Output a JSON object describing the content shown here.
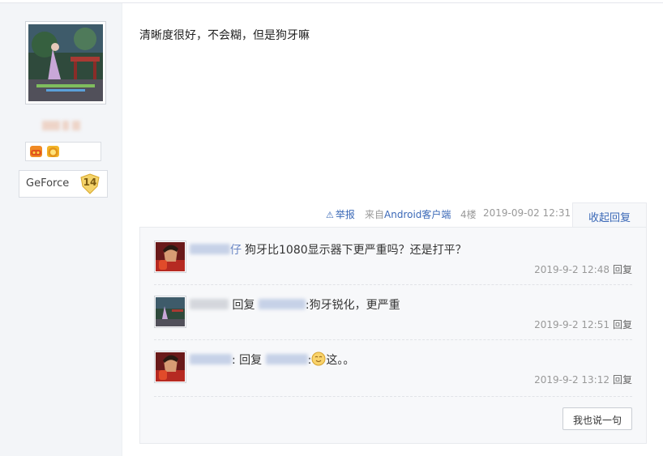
{
  "post": {
    "content": "清晰度很好，不会糊，但是狗牙嘛"
  },
  "author": {
    "level_name": "GeForce",
    "level_number": "14"
  },
  "meta": {
    "report_label": "举报",
    "from_prefix": "来自",
    "from_client": "Android客户端",
    "floor": "4楼",
    "time": "2019-09-02 12:31",
    "collapse_label": "收起回复"
  },
  "replies": [
    {
      "name_tail": "仔",
      "text": "狗牙比1080显示器下更严重吗？还是打平？",
      "time": "2019-9-2 12:48",
      "reply_label": "回复"
    },
    {
      "prefix": "回复",
      "text": ":狗牙锐化，更严重",
      "time": "2019-9-2 12:51",
      "reply_label": "回复"
    },
    {
      "colon": ":",
      "prefix": "回复",
      "colon2": ":",
      "text": "这。。",
      "time": "2019-9-2 13:12",
      "reply_label": "回复"
    }
  ],
  "say_button": "我也说一句",
  "colors": {
    "link_blue": "#3a68b7",
    "sidebar_bg": "#f3f5f8",
    "panel_bg": "#f7f8fa"
  }
}
